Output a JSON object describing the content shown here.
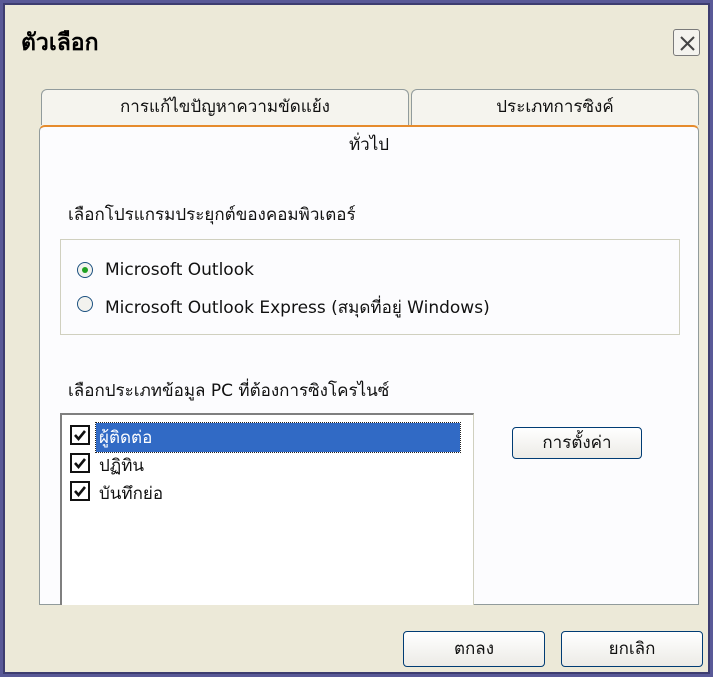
{
  "window": {
    "title": "ตัวเลือก",
    "close_icon": "close-icon"
  },
  "tabs": {
    "conflict": "การแก้ไขปัญหาความขัดแย้ง",
    "sync_type": "ประเภทการซิงค์",
    "general": "ทั่วไป",
    "active": "general"
  },
  "general": {
    "program_label": "เลือกโปรแกรมประยุกต์ของคอมพิวเตอร์",
    "radio_options": [
      {
        "label": "Microsoft Outlook",
        "checked": true
      },
      {
        "label": "Microsoft Outlook Express (สมุดที่อยู่ Windows)",
        "checked": false
      }
    ],
    "datatype_label": "เลือกประเภทข้อมูล PC ที่ต้องการซิงโครไนซ์",
    "data_items": [
      {
        "label": "ผู้ติดต่อ",
        "checked": true,
        "selected": true
      },
      {
        "label": "ปฏิทิน",
        "checked": true,
        "selected": false
      },
      {
        "label": "บันทึกย่อ",
        "checked": true,
        "selected": false
      }
    ],
    "settings_button": "การตั้งค่า"
  },
  "footer": {
    "ok_button": "ตกลง",
    "cancel_button": "ยกเลิก"
  },
  "colors": {
    "frame": "#595997",
    "dialog_bg": "#ece9d8",
    "selection": "#316ac5",
    "active_tab_accent": "#e68b2c",
    "radio_dot": "#21a121"
  }
}
